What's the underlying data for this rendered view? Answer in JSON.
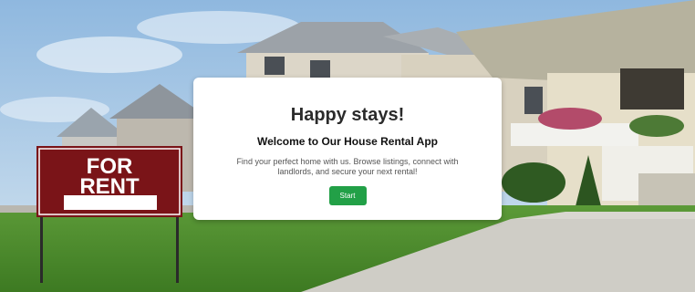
{
  "hero": {
    "background": "house-photo-with-for-rent-sign",
    "sign_text": [
      "FOR",
      "RENT"
    ],
    "accent_color": "#22a047"
  },
  "card": {
    "title": "Happy stays!",
    "subtitle": "Welcome to Our House Rental App",
    "description": "Find your perfect home with us. Browse listings, connect with landlords, and secure your next rental!",
    "start_label": "Start"
  }
}
